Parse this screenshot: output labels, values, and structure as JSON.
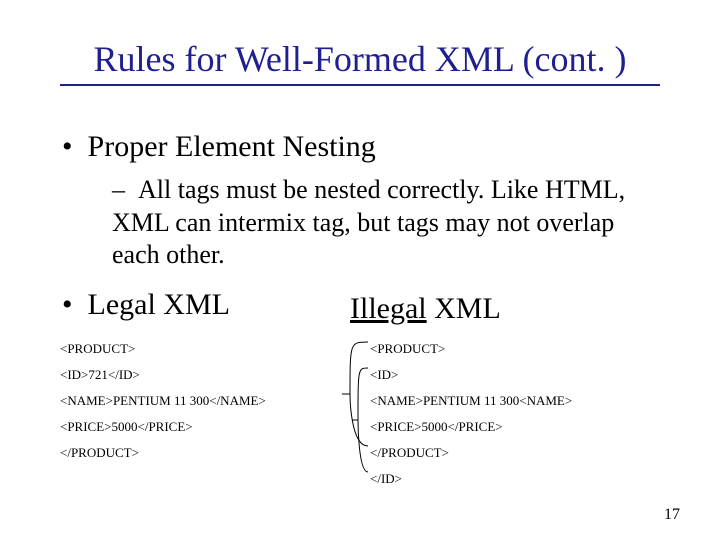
{
  "title": "Rules for Well-Formed XML (cont. )",
  "bullet1": {
    "marker": "•",
    "text": "Proper Element Nesting"
  },
  "sub1": {
    "marker": "–",
    "text": "All tags must be nested correctly. Like HTML, XML can intermix tag, but tags may not overlap each other."
  },
  "bullet2": {
    "marker": "•",
    "text": "Legal XML"
  },
  "bullet3": {
    "underlined": "Illegal",
    "rest": " XML"
  },
  "legal_code": {
    "l1": "<PRODUCT>",
    "l2": "<ID>721</ID>",
    "l3": "<NAME>PENTIUM 11 300</NAME>",
    "l4": "<PRICE>5000</PRICE>",
    "l5": "</PRODUCT>"
  },
  "illegal_code": {
    "l1": "<PRODUCT>",
    "l2": "<ID>",
    "l3": "<NAME>PENTIUM 11 300<NAME>",
    "l4": "<PRICE>5000</PRICE>",
    "l5": "</PRODUCT>",
    "l6": "</ID>"
  },
  "page_number": "17"
}
